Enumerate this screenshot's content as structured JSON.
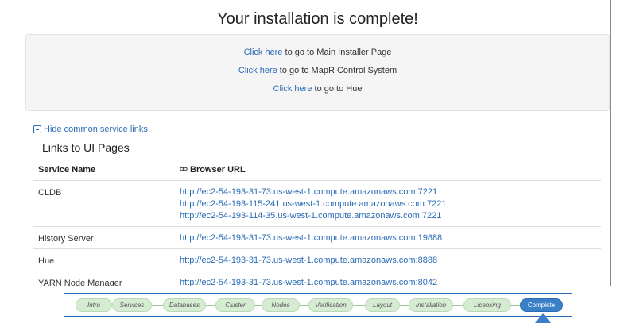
{
  "page": {
    "title": "Your installation is complete!"
  },
  "quick_links": [
    {
      "link": "Click here",
      "text": " to go to Main Installer Page"
    },
    {
      "link": "Click here",
      "text": " to go to MapR Control System"
    },
    {
      "link": "Click here",
      "text": " to go to Hue"
    }
  ],
  "toggle_label": "Hide common service links",
  "section_title": "Links to UI Pages",
  "table": {
    "headers": {
      "service": "Service Name",
      "url": "Browser URL"
    },
    "rows": [
      {
        "service": "CLDB",
        "urls": [
          "http://ec2-54-193-31-73.us-west-1.compute.amazonaws.com:7221",
          "http://ec2-54-193-115-241.us-west-1.compute.amazonaws.com:7221",
          "http://ec2-54-193-114-35.us-west-1.compute.amazonaws.com:7221"
        ]
      },
      {
        "service": "History Server",
        "urls": [
          "http://ec2-54-193-31-73.us-west-1.compute.amazonaws.com:19888"
        ]
      },
      {
        "service": "Hue",
        "urls": [
          "http://ec2-54-193-31-73.us-west-1.compute.amazonaws.com:8888"
        ]
      },
      {
        "service": "YARN Node Manager",
        "urls": [
          "http://ec2-54-193-31-73.us-west-1.compute.amazonaws.com:8042"
        ]
      }
    ]
  },
  "wizard": {
    "steps": [
      "Intro",
      "Services",
      "Databases",
      "Cluster",
      "Nodes",
      "Verification",
      "Layout",
      "Installation",
      "Licensing",
      "Complete"
    ],
    "active": "Complete"
  },
  "colors": {
    "link": "#2a6bb5",
    "step_done": "#d6ecd2",
    "step_active": "#3a80c8"
  }
}
